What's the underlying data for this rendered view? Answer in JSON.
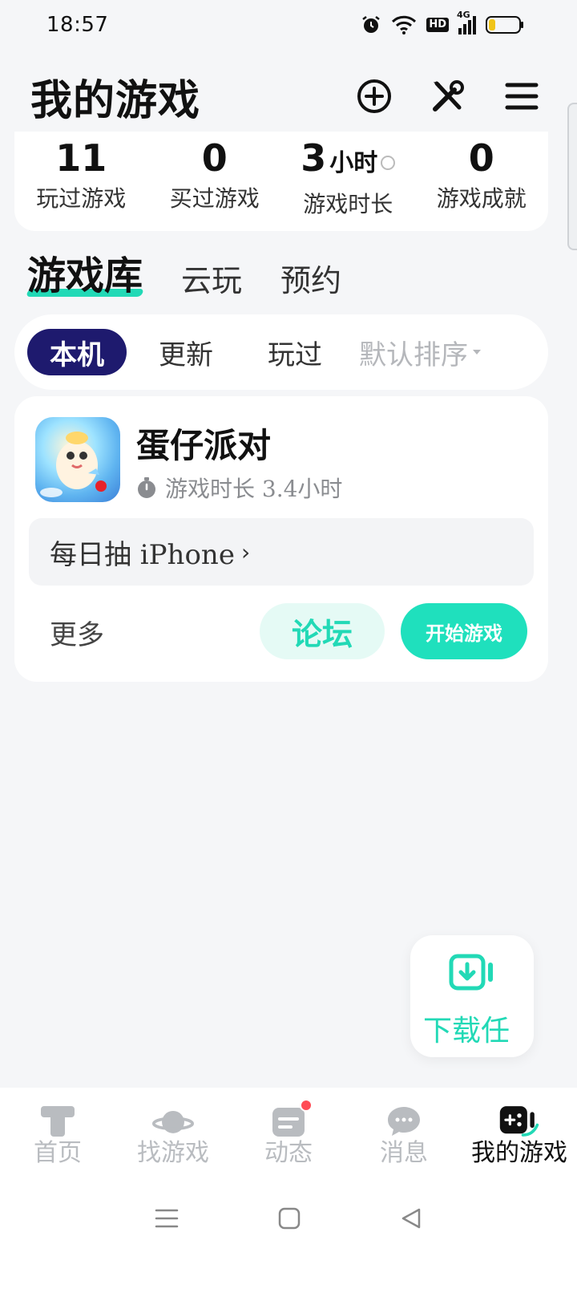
{
  "status_bar": {
    "time": "18:57",
    "network": "4G",
    "hd": "HD"
  },
  "header": {
    "title": "我的游戏"
  },
  "stats": [
    {
      "value": "11",
      "unit": "",
      "label": "玩过游戏"
    },
    {
      "value": "0",
      "unit": "",
      "label": "买过游戏"
    },
    {
      "value": "3",
      "unit": "小时",
      "label": "游戏时长"
    },
    {
      "value": "0",
      "unit": "",
      "label": "游戏成就"
    }
  ],
  "library_tabs": [
    "游戏库",
    "云玩",
    "预约"
  ],
  "filters": {
    "chips": [
      "本机",
      "更新",
      "玩过"
    ],
    "sort_label": "默认排序"
  },
  "game": {
    "name": "蛋仔派对",
    "playtime_label": "游戏时长 3.4小时",
    "promo_text": "每日抽 iPhone",
    "more_label": "更多",
    "forum_label": "论坛",
    "start_label": "开始游戏"
  },
  "download_fab": {
    "label": "下载任"
  },
  "bottom_nav": [
    {
      "label": "首页",
      "icon": "home-icon"
    },
    {
      "label": "找游戏",
      "icon": "planet-icon"
    },
    {
      "label": "动态",
      "icon": "feed-icon"
    },
    {
      "label": "消息",
      "icon": "message-icon"
    },
    {
      "label": "我的游戏",
      "icon": "gamepad-icon"
    }
  ],
  "colors": {
    "accent": "#22d9b6",
    "chip_active": "#1e1a6e",
    "badge": "#ff4b55"
  }
}
